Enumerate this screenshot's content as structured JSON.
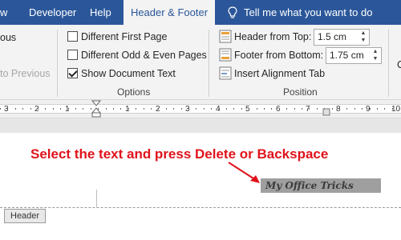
{
  "tabs": [
    {
      "label": "w",
      "active": false
    },
    {
      "label": "Developer",
      "active": false
    },
    {
      "label": "Help",
      "active": false
    },
    {
      "label": "Header & Footer",
      "active": true
    }
  ],
  "tell_me": "Tell me what you want to do",
  "navigation": {
    "previous_label": "ous",
    "goto_previous_label": "to Previous"
  },
  "options": {
    "different_first_page": {
      "label": "Different First Page",
      "checked": false
    },
    "different_odd_even": {
      "label": "Different Odd & Even Pages",
      "checked": false
    },
    "show_document_text": {
      "label": "Show Document Text",
      "checked": true
    },
    "group_label": "Options"
  },
  "position": {
    "header_from_top": {
      "label": "Header from Top:",
      "value": "1.5 cm"
    },
    "footer_from_bottom": {
      "label": "Footer from Bottom:",
      "value": "1.75 cm"
    },
    "insert_alignment_tab": "Insert Alignment Tab",
    "group_label": "Position",
    "clipped_label": "C"
  },
  "ruler": {
    "numbers": [
      "3",
      "2",
      "1",
      "1",
      "2",
      "3",
      "4",
      "5",
      "6",
      "7",
      "8",
      "9",
      "10"
    ]
  },
  "document": {
    "annotation": "Select the text and press Delete or Backspace",
    "selected_text": "My Office Tricks",
    "header_tag": "Header"
  },
  "colors": {
    "ribbon_blue": "#2b579a",
    "annotation_red": "#e0131b",
    "selection_gray": "#9f9f9f"
  }
}
